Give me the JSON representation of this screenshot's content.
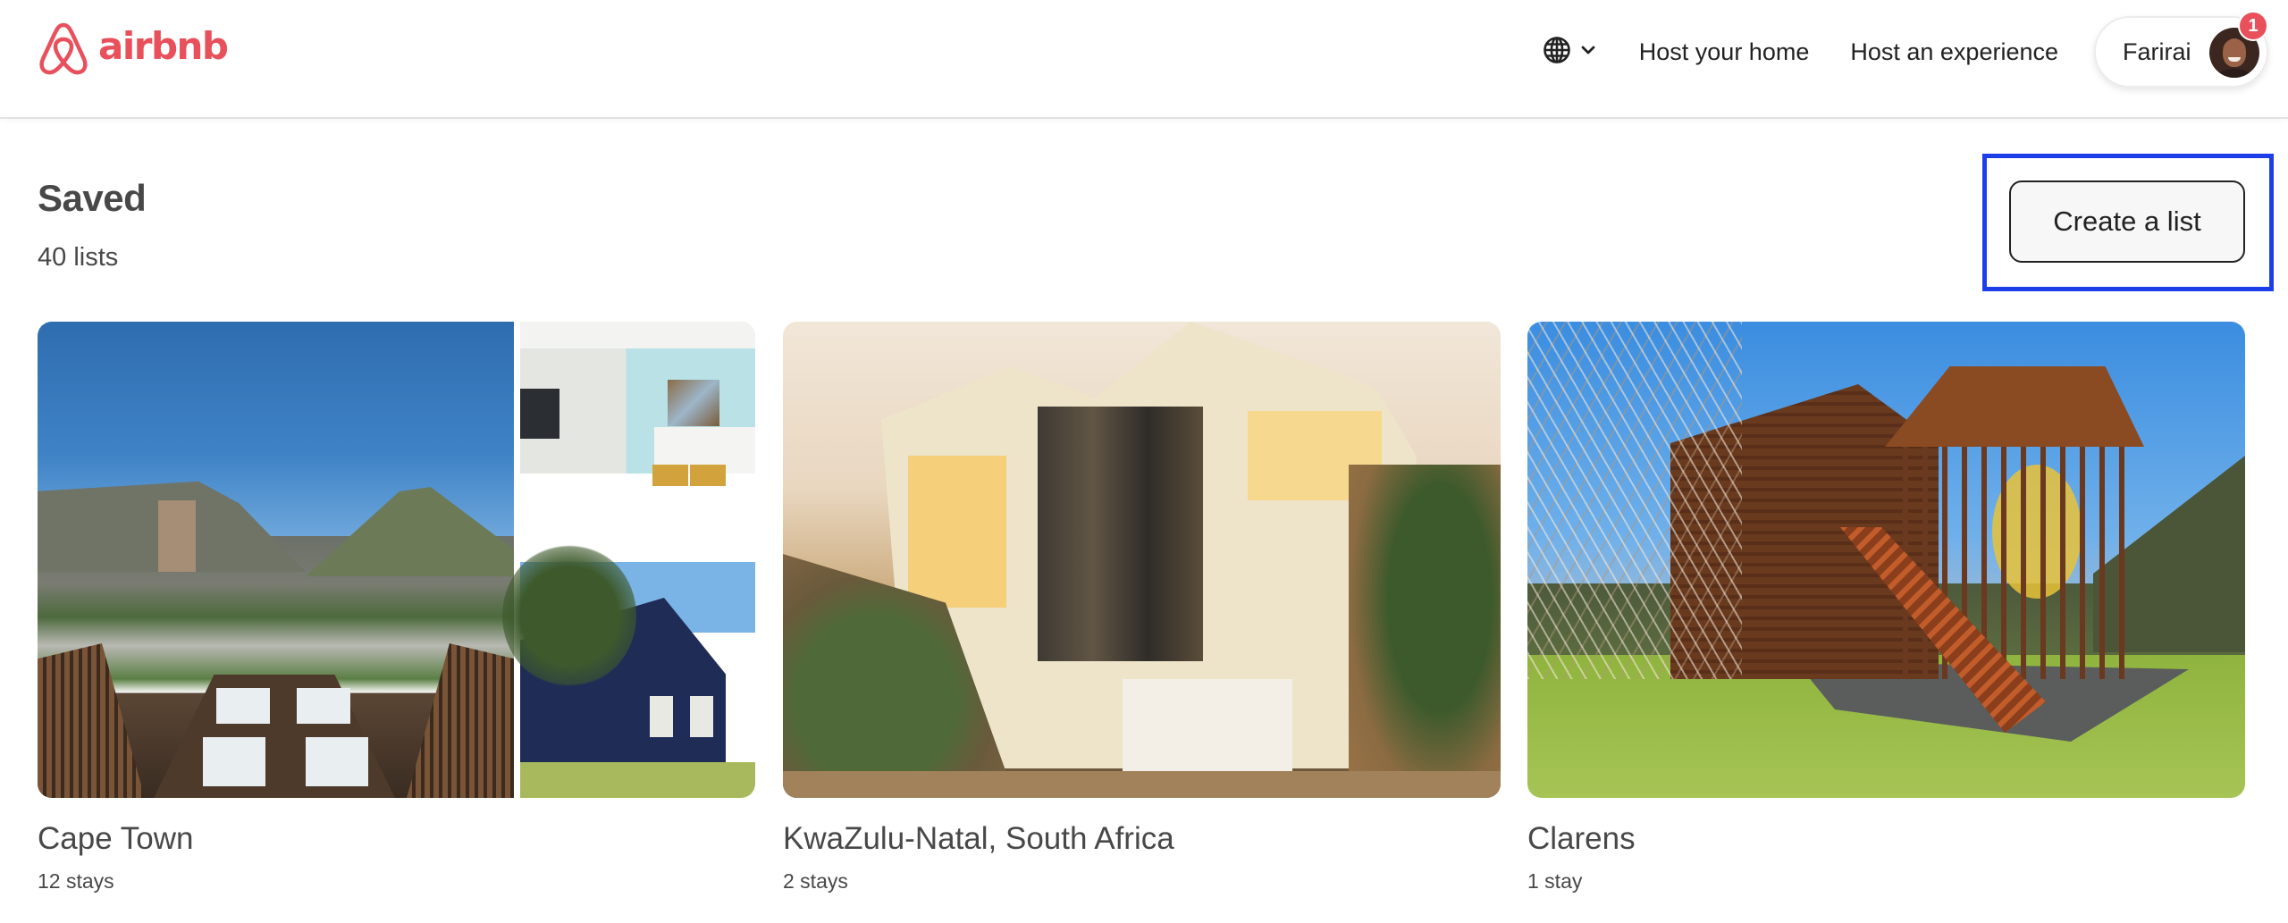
{
  "header": {
    "brand": "airbnb",
    "brand_color": "#E8505B",
    "language_icon": "globe-icon",
    "language_chevron_icon": "chevron-down-icon",
    "nav_links": [
      "Host your home",
      "Host an experience"
    ],
    "profile": {
      "name": "Farirai",
      "notification_count": "1"
    }
  },
  "page": {
    "title": "Saved",
    "subtitle": "40 lists",
    "create_list_label": "Create a list",
    "highlight_color": "#1D3DE8"
  },
  "lists": [
    {
      "title": "Cape Town",
      "subtitle": "12 stays"
    },
    {
      "title": "KwaZulu-Natal, South Africa",
      "subtitle": "2 stays"
    },
    {
      "title": "Clarens",
      "subtitle": "1 stay"
    }
  ]
}
